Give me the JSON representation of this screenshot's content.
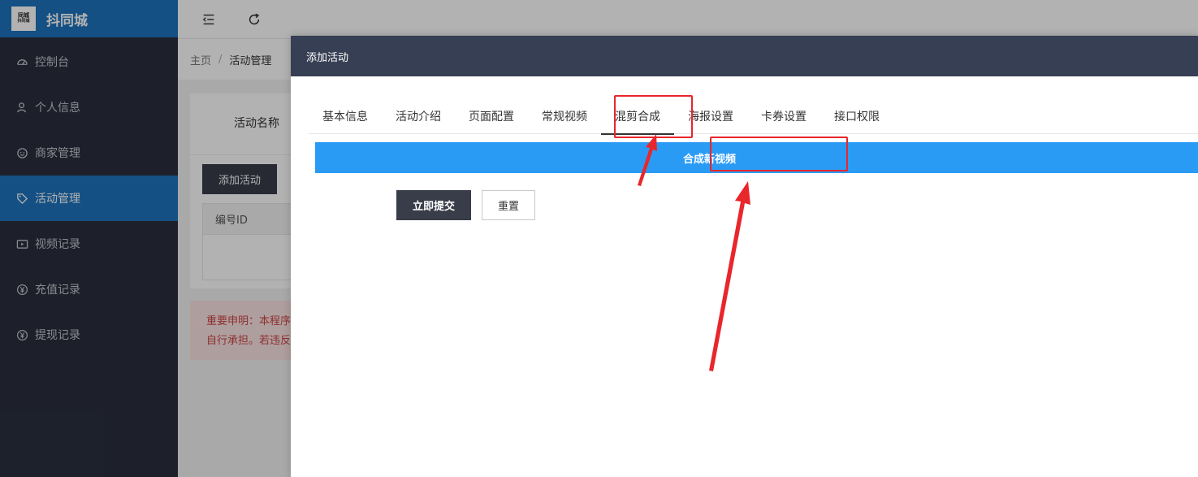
{
  "app": {
    "logo_line1": "同城",
    "logo_line2": "抖同城",
    "name": "抖同城"
  },
  "sidebar": {
    "items": [
      {
        "label": "控制台",
        "icon": "dashboard-icon"
      },
      {
        "label": "个人信息",
        "icon": "user-icon"
      },
      {
        "label": "商家管理",
        "icon": "smile-icon"
      },
      {
        "label": "活动管理",
        "icon": "tag-icon",
        "active": true
      },
      {
        "label": "视频记录",
        "icon": "video-icon"
      },
      {
        "label": "充值记录",
        "icon": "yen-icon"
      },
      {
        "label": "提现记录",
        "icon": "yen-icon"
      }
    ]
  },
  "topbar": {
    "collapse_icon": "menu-collapse-icon",
    "refresh_icon": "refresh-icon"
  },
  "breadcrumb": {
    "home": "主页",
    "separator": "/",
    "current": "活动管理"
  },
  "page": {
    "filter_label": "活动名称",
    "add_button": "添加活动",
    "table_header_id": "编号ID",
    "notice_line1": "重要申明：本程序",
    "notice_line2": "自行承担。若违反"
  },
  "modal": {
    "title": "添加活动",
    "tabs": [
      "基本信息",
      "活动介绍",
      "页面配置",
      "常规视频",
      "混剪合成",
      "海报设置",
      "卡券设置",
      "接口权限"
    ],
    "active_tab": "混剪合成",
    "synth_button": "合成新视频",
    "submit_button": "立即提交",
    "reset_button": "重置"
  },
  "colors": {
    "sidebar_bg": "#2a2f3e",
    "accent": "#1e73be",
    "modal_header": "#373f54",
    "synth_bar": "#2a9bf5",
    "dark_button": "#393d49",
    "annotation": "#e8262b"
  }
}
